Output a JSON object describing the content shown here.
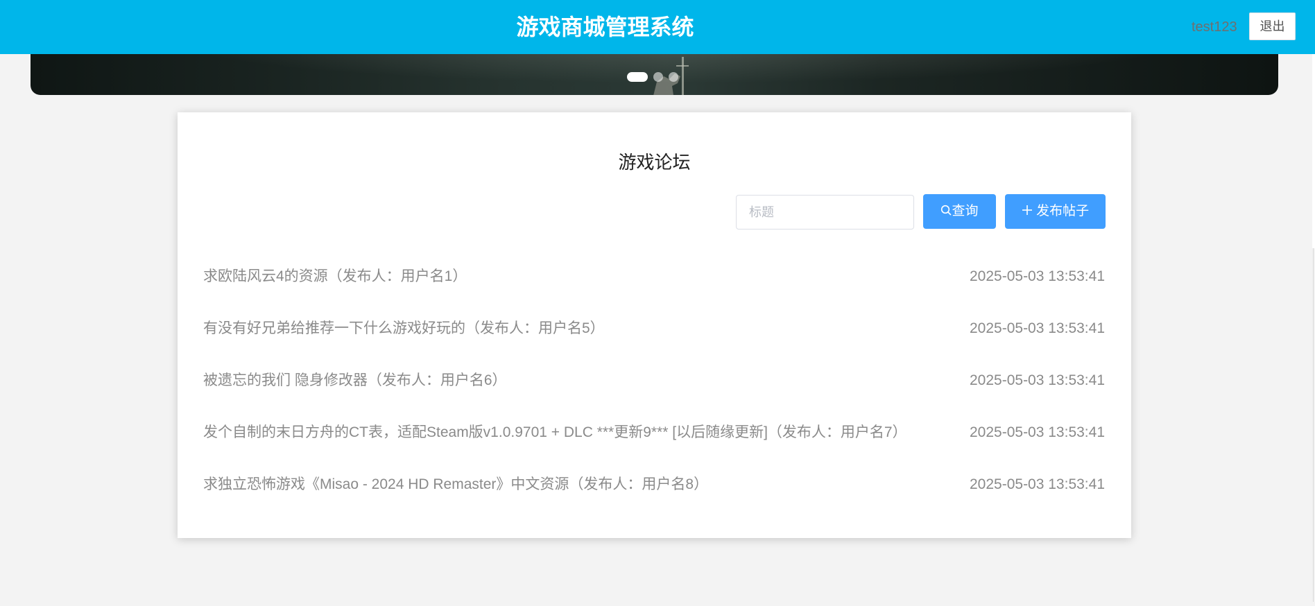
{
  "header": {
    "title": "游戏商城管理系统",
    "username": "test123",
    "logout_label": "退出",
    "background_color": "#00b6ea"
  },
  "banner": {
    "slide_count": 3,
    "active_slide": 1
  },
  "forum": {
    "title": "游戏论坛",
    "search_placeholder": "标题",
    "search_value": "",
    "query_label": "查询",
    "post_label": "发布帖子",
    "accent_color": "#409eff",
    "posts": [
      {
        "title": "求欧陆风云4的资源（发布人：用户名1）",
        "time": "2025-05-03 13:53:41"
      },
      {
        "title": "有没有好兄弟给推荐一下什么游戏好玩的（发布人：用户名5）",
        "time": "2025-05-03 13:53:41"
      },
      {
        "title": "被遗忘的我们 隐身修改器（发布人：用户名6）",
        "time": "2025-05-03 13:53:41"
      },
      {
        "title": "发个自制的末日方舟的CT表，适配Steam版v1.0.9701 + DLC ***更新9*** [以后随缘更新]（发布人：用户名7）",
        "time": "2025-05-03 13:53:41"
      },
      {
        "title": "求独立恐怖游戏《Misao - 2024 HD Remaster》中文资源（发布人：用户名8）",
        "time": "2025-05-03 13:53:41"
      }
    ]
  },
  "icons": {
    "query": "search-icon",
    "post": "plus-icon"
  }
}
